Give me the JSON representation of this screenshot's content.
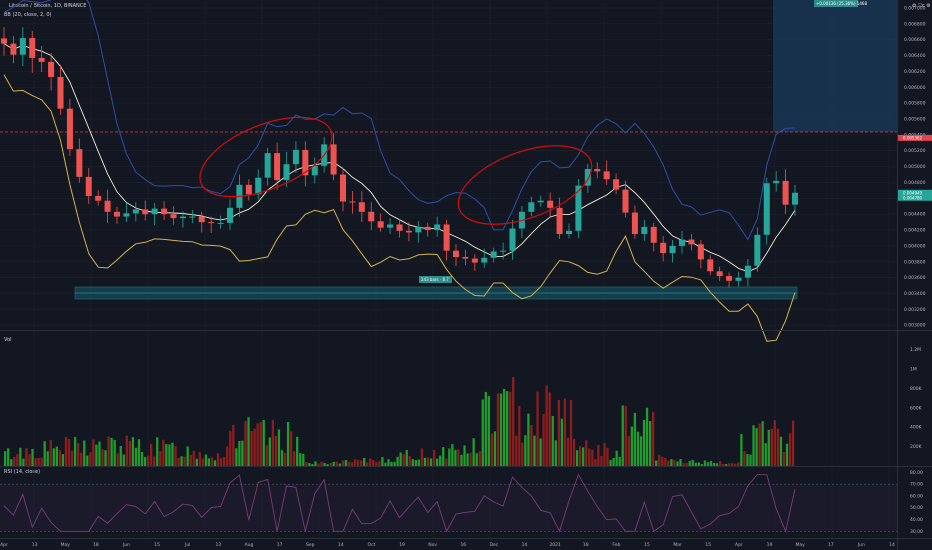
{
  "header": {
    "symbol": "Litecoin / Bitcoin, 1D, BINANCE",
    "bb_label": "BB (20, close, 2, 0)",
    "vol_label": "Vol",
    "rsi_label": "RSI (14, close)",
    "settings": "⚙ ▽c ⚙"
  },
  "colors": {
    "background": "#131722",
    "grid": "#1e222d",
    "up": "#26a69a",
    "down": "#ef5350",
    "vol_up": "#1f9e2c",
    "vol_down": "#8e1e1e",
    "bb_upper": "#2c4fa8",
    "bb_basis": "#f2eed0",
    "bb_lower": "#d4b24a",
    "ellipse": "#d10d0d",
    "resistance": "#e0454f",
    "support_zone": "#17566a",
    "rsi": "#7b3b7b"
  },
  "price_axis": {
    "ticks": [
      "0.007000",
      "0.006800",
      "0.006600",
      "0.006400",
      "0.006200",
      "0.006000",
      "0.005800",
      "0.005600",
      "0.005400",
      "0.005200",
      "0.005000",
      "0.004800",
      "0.004600",
      "0.004400",
      "0.004200",
      "0.004000",
      "0.003800",
      "0.003600",
      "0.003400",
      "0.003200",
      "0.003000"
    ],
    "current_resistance": "0.005362",
    "current_price": "0.004949",
    "current_price_sub": "0.004780"
  },
  "volume_axis": {
    "ticks": [
      "1.2M",
      "1M",
      "800K",
      "600K",
      "400K",
      "200K"
    ]
  },
  "rsi_axis": {
    "ticks": [
      "80.00",
      "70.00",
      "60.00",
      "50.00",
      "40.00",
      "30.00"
    ]
  },
  "time_axis": {
    "labels": [
      "Apr",
      "13",
      "May",
      "18",
      "Jun",
      "15",
      "Jul",
      "13",
      "Aug",
      "17",
      "Sep",
      "14",
      "Oct",
      "19",
      "Nov",
      "16",
      "Dec",
      "14",
      "2021",
      "18",
      "Feb",
      "15",
      "Mar",
      "15",
      "Apr",
      "19",
      "May",
      "17",
      "Jun",
      "14"
    ]
  },
  "annotations": {
    "support_label": "243 bars · 8.7",
    "projection_label": "+0.00136 (25.36%) 1468"
  },
  "chart_data": {
    "type": "candlestick",
    "resistance_level": 0.005362,
    "support_zone": [
      0.00318,
      0.00329
    ],
    "close": [
      0.00655,
      0.00641,
      0.00662,
      0.00637,
      0.00632,
      0.00613,
      0.00573,
      0.00522,
      0.00487,
      0.00463,
      0.00457,
      0.00443,
      0.00437,
      0.00441,
      0.00446,
      0.0044,
      0.00447,
      0.0044,
      0.00435,
      0.00437,
      0.00437,
      0.0043,
      0.00429,
      0.00429,
      0.00448,
      0.00477,
      0.00465,
      0.00486,
      0.00517,
      0.00483,
      0.00503,
      0.00521,
      0.00489,
      0.00501,
      0.00528,
      0.0049,
      0.00456,
      0.00455,
      0.00443,
      0.00431,
      0.00423,
      0.00427,
      0.00419,
      0.00417,
      0.00424,
      0.0042,
      0.00427,
      0.00394,
      0.00386,
      0.00384,
      0.00379,
      0.00385,
      0.00393,
      0.00394,
      0.00422,
      0.00443,
      0.00455,
      0.00457,
      0.00448,
      0.00415,
      0.00419,
      0.00476,
      0.00497,
      0.00494,
      0.00484,
      0.00471,
      0.00442,
      0.00415,
      0.00424,
      0.00404,
      0.00391,
      0.004,
      0.00408,
      0.00402,
      0.00383,
      0.00368,
      0.00362,
      0.00356,
      0.0036,
      0.00375,
      0.00414,
      0.00479,
      0.00482,
      0.00452,
      0.00467
    ]
  }
}
